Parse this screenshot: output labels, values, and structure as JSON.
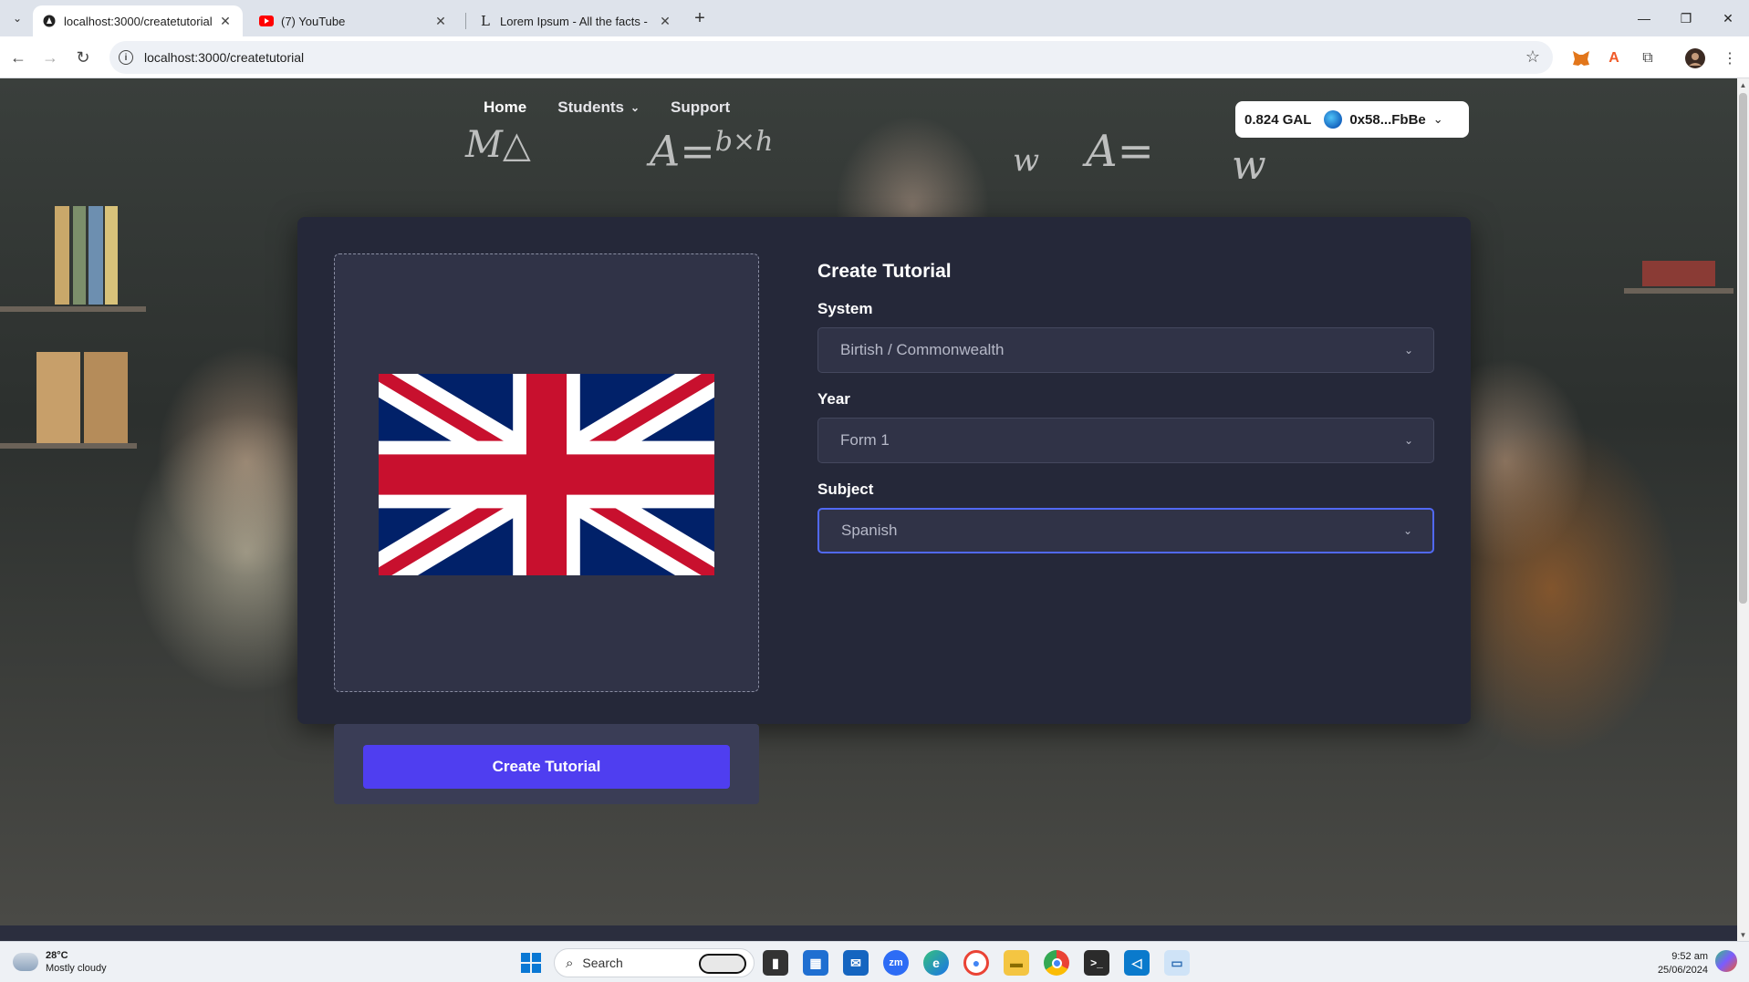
{
  "browser": {
    "tabs": [
      {
        "title": "localhost:3000/createtutorial",
        "active": true,
        "icon": "globe-icon"
      },
      {
        "title": "(7) YouTube",
        "active": false,
        "icon": "youtube-icon"
      },
      {
        "title": "Lorem Ipsum - All the facts - Li",
        "active": false,
        "icon": "lipsum-icon"
      }
    ],
    "url": "localhost:3000/createtutorial"
  },
  "nav": {
    "home": "Home",
    "students": "Students",
    "support": "Support"
  },
  "wallet": {
    "balance": "0.824 GAL",
    "address": "0x58...FbBe"
  },
  "form": {
    "title": "Create Tutorial",
    "system_label": "System",
    "system_value": "Birtish / Commonwealth",
    "year_label": "Year",
    "year_value": "Form 1",
    "subject_label": "Subject",
    "subject_value": "Spanish",
    "submit_label": "Create Tutorial"
  },
  "taskbar": {
    "temperature": "28°C",
    "weather": "Mostly cloudy",
    "search_placeholder": "Search",
    "time": "9:52 am",
    "date": "25/06/2024"
  },
  "colors": {
    "accent": "#4f3ef0",
    "card": "#252839",
    "focus": "#5169f4"
  }
}
